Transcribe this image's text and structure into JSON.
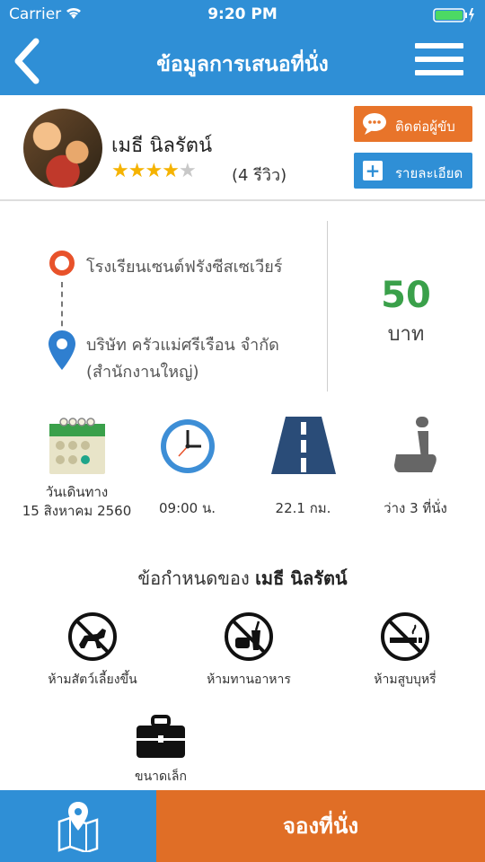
{
  "status_bar": {
    "carrier": "Carrier",
    "time": "9:20 PM"
  },
  "nav": {
    "title": "ข้อมูลการเสนอที่นั่ง"
  },
  "driver": {
    "name": "เมธี นิลรัตน์",
    "rating": 4,
    "rating_max": 5,
    "reviews": "(4 รีวิว)",
    "contact_label": "ติดต่อผู้ขับ",
    "detail_label": "รายละเอียด"
  },
  "route": {
    "from": "โรงเรียนเซนต์ฟรังซีสเซเวียร์",
    "to_line1": "บริษัท ครัวแม่ศรีเรือน จำกัด",
    "to_line2": "(สำนักงานใหญ่)",
    "price": "50",
    "unit": "บาท"
  },
  "trip": {
    "date_label": "วันเดินทาง",
    "date_value": "15 สิงหาคม 2560",
    "time": "09:00 น.",
    "distance": "22.1 กม.",
    "seats": "ว่าง 3 ที่นั่ง"
  },
  "rules": {
    "title_prefix": "ข้อกำหนดของ",
    "title_name": "เมธี นิลรัตน์",
    "items": [
      "ห้ามสัตว์เลี้ยงขึ้น",
      "ห้ามทานอาหาร",
      "ห้ามสูบบุหรี่",
      "ขนาดเล็ก"
    ]
  },
  "footer": {
    "book_label": "จองที่นั่ง"
  },
  "colors": {
    "primary": "#2f8fd6",
    "accent": "#e06e26",
    "price": "#3aa04a"
  }
}
